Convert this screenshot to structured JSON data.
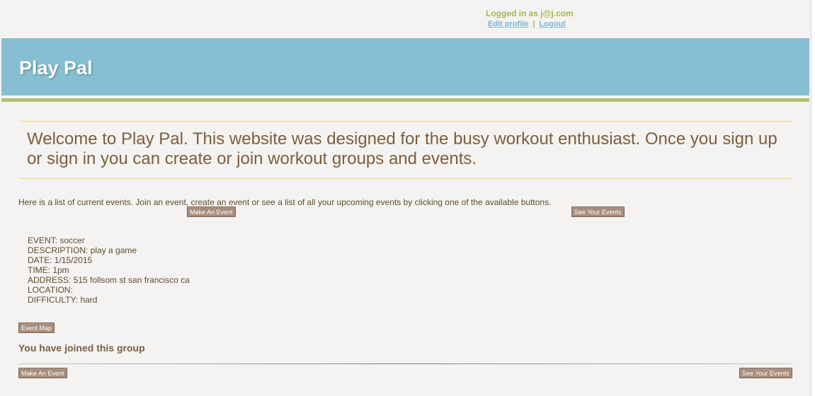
{
  "user": {
    "logged_in": "Logged in as j@j.com",
    "edit_profile": "Edit profile",
    "separator": "|",
    "logout": "Logout"
  },
  "header": {
    "title": "Play Pal"
  },
  "welcome": {
    "text": "Welcome to Play Pal. This website was designed for the busy workout enthusiast. Once you sign up or sign in you can create or join workout groups and events."
  },
  "intro": {
    "text": "Here is a list of current events. Join an event, create an event or see a list of all your upcoming events by clicking one of the available buttons."
  },
  "buttons": {
    "make_event": "Make An Event",
    "see_events": "See Your Events",
    "event_map": "Event Map"
  },
  "event": {
    "event": "EVENT: soccer",
    "description": "DESCRIPTION: play a game",
    "date": "DATE: 1/15/2015",
    "time": "TIME: 1pm",
    "address": "ADDRESS: 515 follsom st san francisco ca",
    "location": "LOCATION:",
    "difficulty": "DIFFICULTY: hard"
  },
  "status": {
    "joined": "You have joined this group"
  }
}
